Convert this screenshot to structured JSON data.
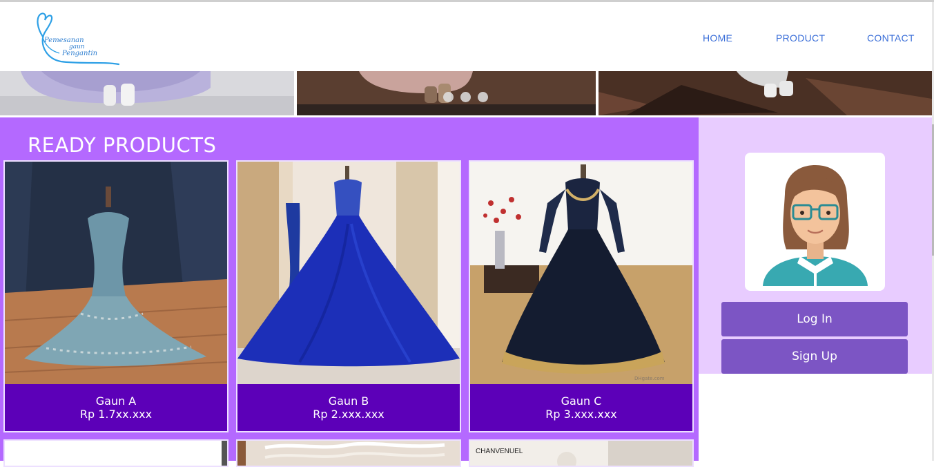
{
  "logo": {
    "line1": "Pemesanan",
    "line2": "gaun",
    "line3": "Pengantin"
  },
  "nav": {
    "home": "HOME",
    "product": "PRODUCT",
    "contact": "CONTACT"
  },
  "main": {
    "title": "READY PRODUCTS",
    "products": [
      {
        "name": "Gaun A",
        "price": "Rp 1.7xx.xxx"
      },
      {
        "name": "Gaun B",
        "price": "Rp 2.xxx.xxx"
      },
      {
        "name": "Gaun C",
        "price": "Rp 3.xxx.xxx"
      }
    ],
    "next_row_brand": "CHANVENUEL"
  },
  "sidebar": {
    "login_label": "Log In",
    "signup_label": "Sign Up"
  },
  "colors": {
    "accent": "#b469ff",
    "caption": "#5c00b8",
    "sidebar": "#e8ccff",
    "button": "#7c55c4",
    "nav": "#3a6ed8"
  }
}
